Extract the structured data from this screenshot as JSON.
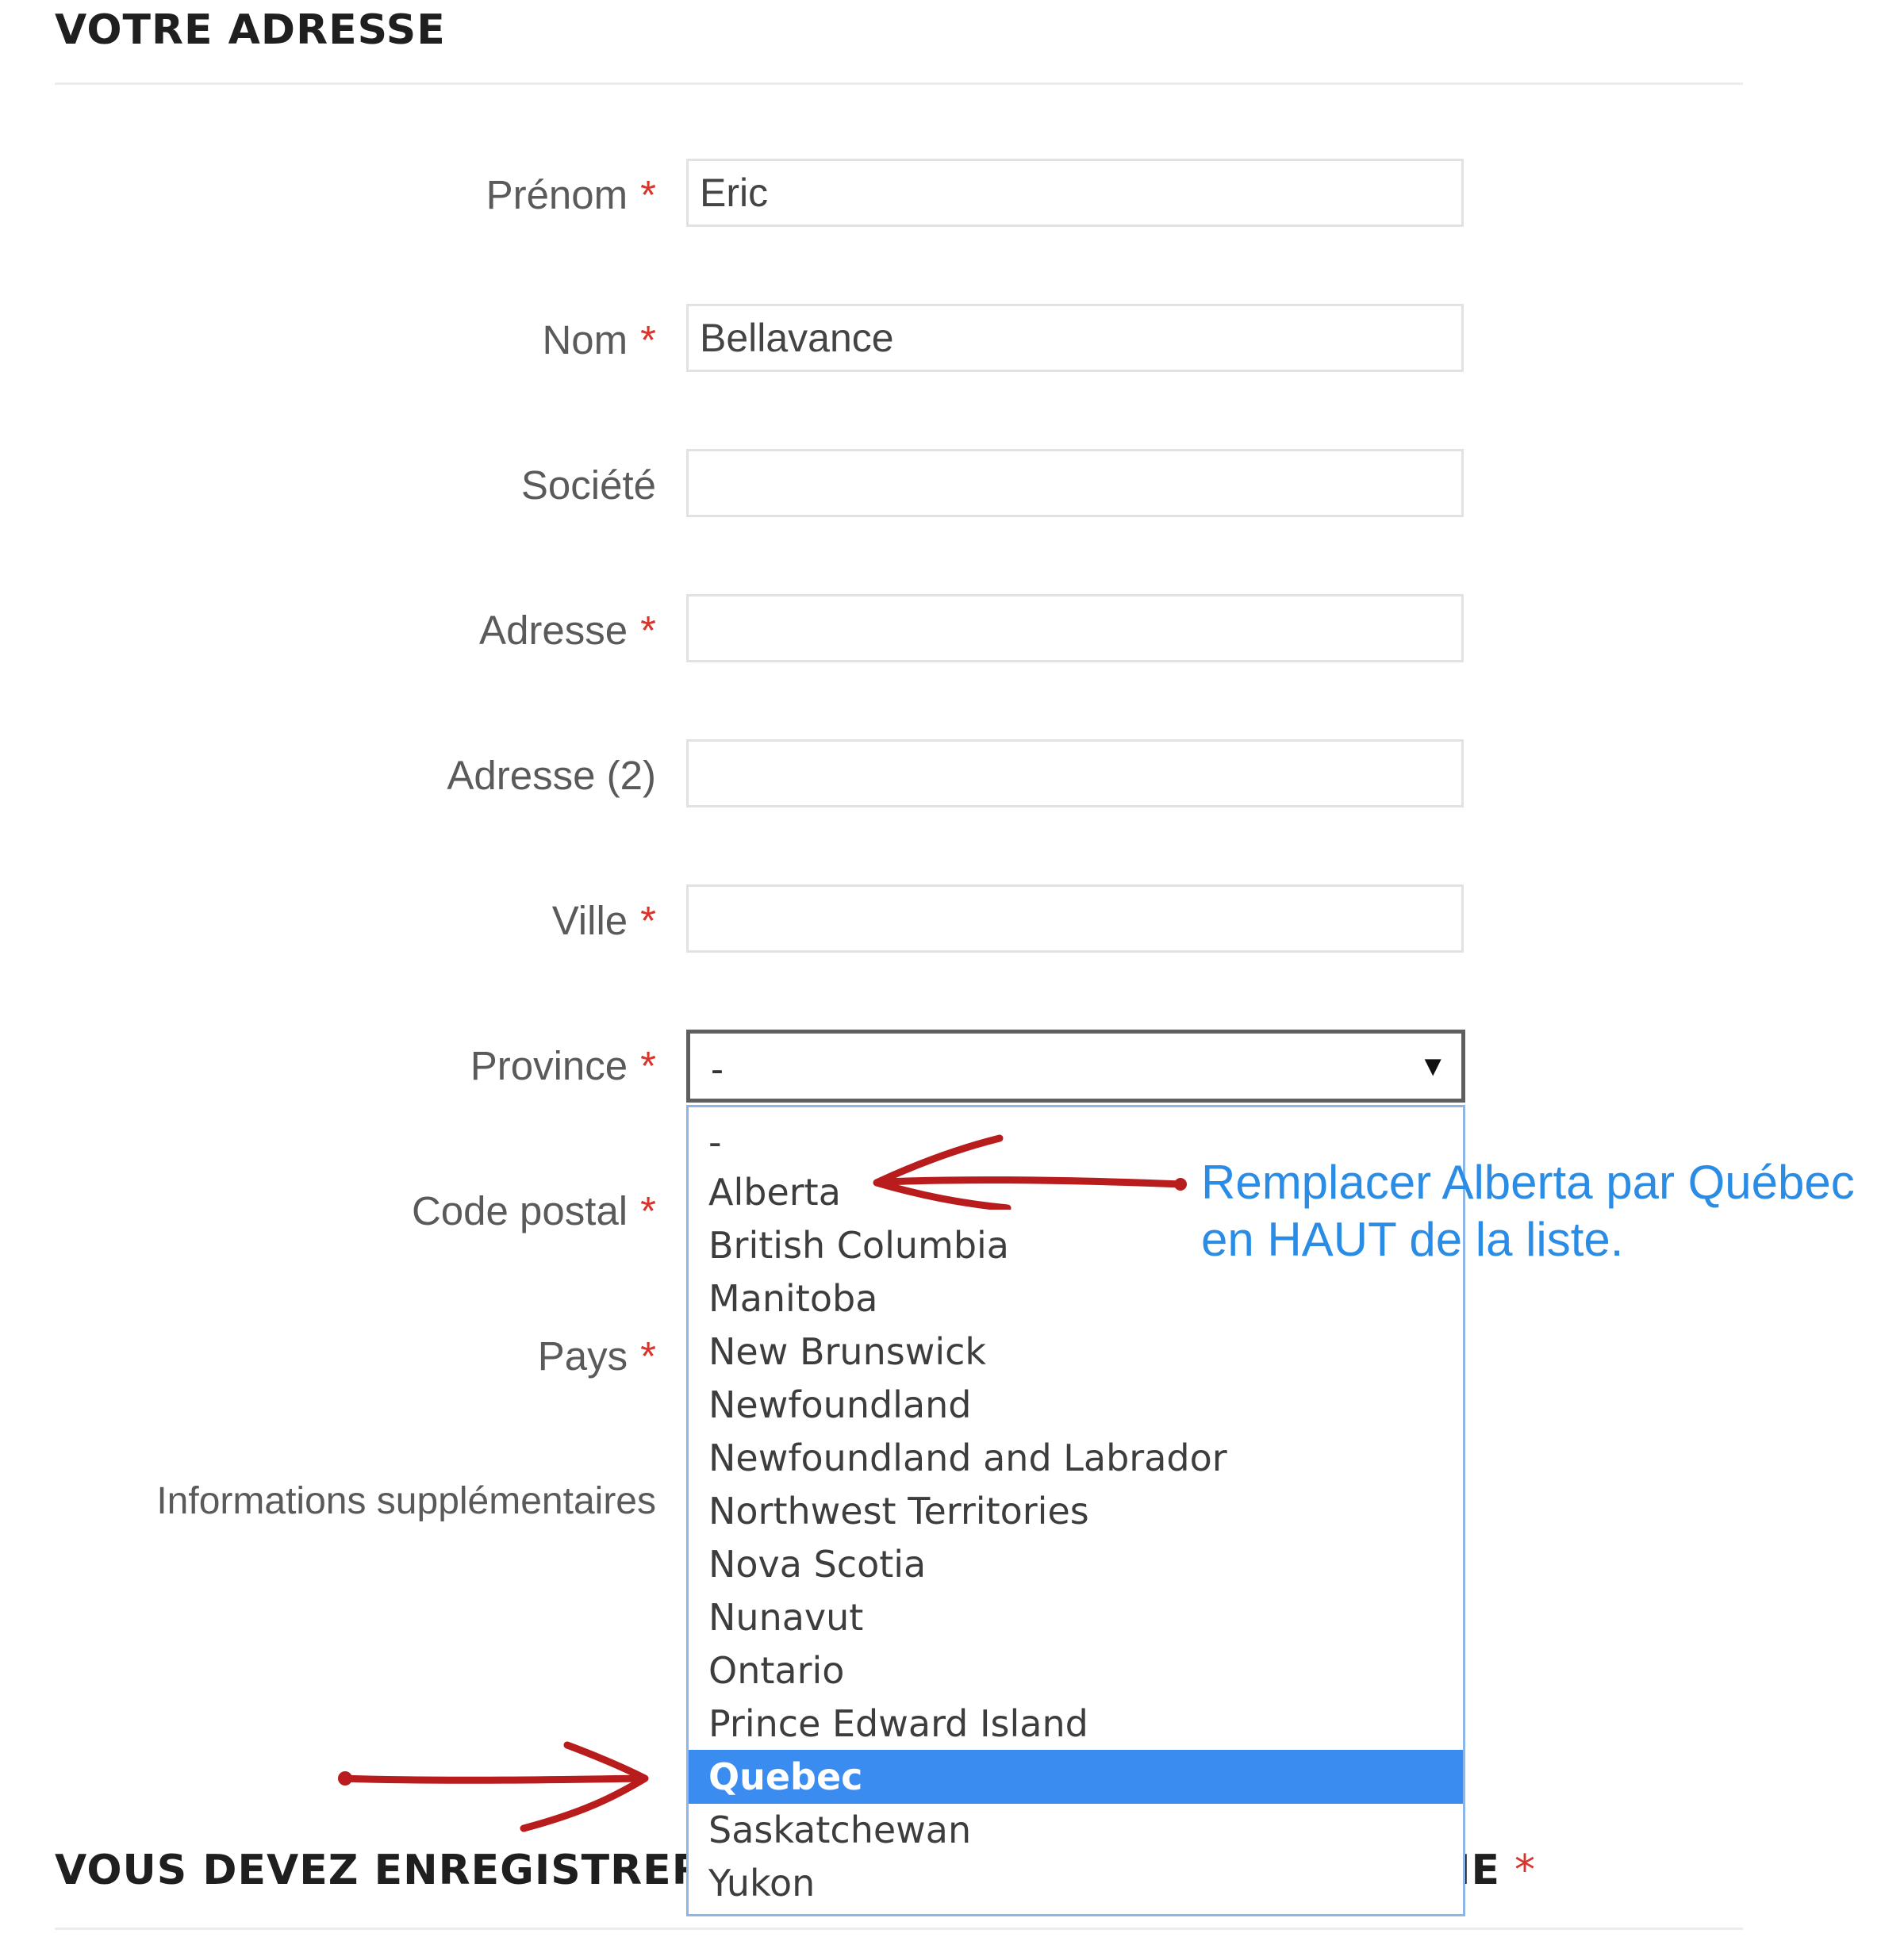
{
  "section": {
    "title": "VOTRE ADRESSE",
    "footer_title_left": "VOUS DEVEZ ENREGISTRER",
    "footer_title_right": "NE",
    "footer_required_mark": "*"
  },
  "form": {
    "required_mark": "*",
    "fields": [
      {
        "label": "Prénom",
        "value": "Eric"
      },
      {
        "label": "Nom",
        "value": "Bellavance"
      },
      {
        "label": "Société",
        "value": ""
      },
      {
        "label": "Adresse",
        "value": ""
      },
      {
        "label": "Adresse (2)",
        "value": ""
      },
      {
        "label": "Ville",
        "value": ""
      }
    ],
    "province": {
      "label": "Province",
      "selected": "-"
    },
    "code_postal_label": "Code postal",
    "pays_label": "Pays",
    "info_label": "Informations supplémentaires"
  },
  "dropdown": {
    "options": [
      "-",
      "Alberta",
      "British Columbia",
      "Manitoba",
      "New Brunswick",
      "Newfoundland",
      "Newfoundland and Labrador",
      "Northwest Territories",
      "Nova Scotia",
      "Nunavut",
      "Ontario",
      "Prince Edward Island",
      "Quebec",
      "Saskatchewan",
      "Yukon"
    ],
    "highlighted": "Quebec"
  },
  "annotation": {
    "line1": "Remplacer Alberta par Québec",
    "line2": "en HAUT de la liste."
  },
  "colors": {
    "accent_required": "#d9342b",
    "highlight": "#3b8cf0",
    "annotation_text": "#2b8ce6",
    "arrow": "#b81c1c"
  },
  "icons": {
    "select_arrow": "triangle-down-icon",
    "annotation_arrows": "red-arrow-icon"
  }
}
